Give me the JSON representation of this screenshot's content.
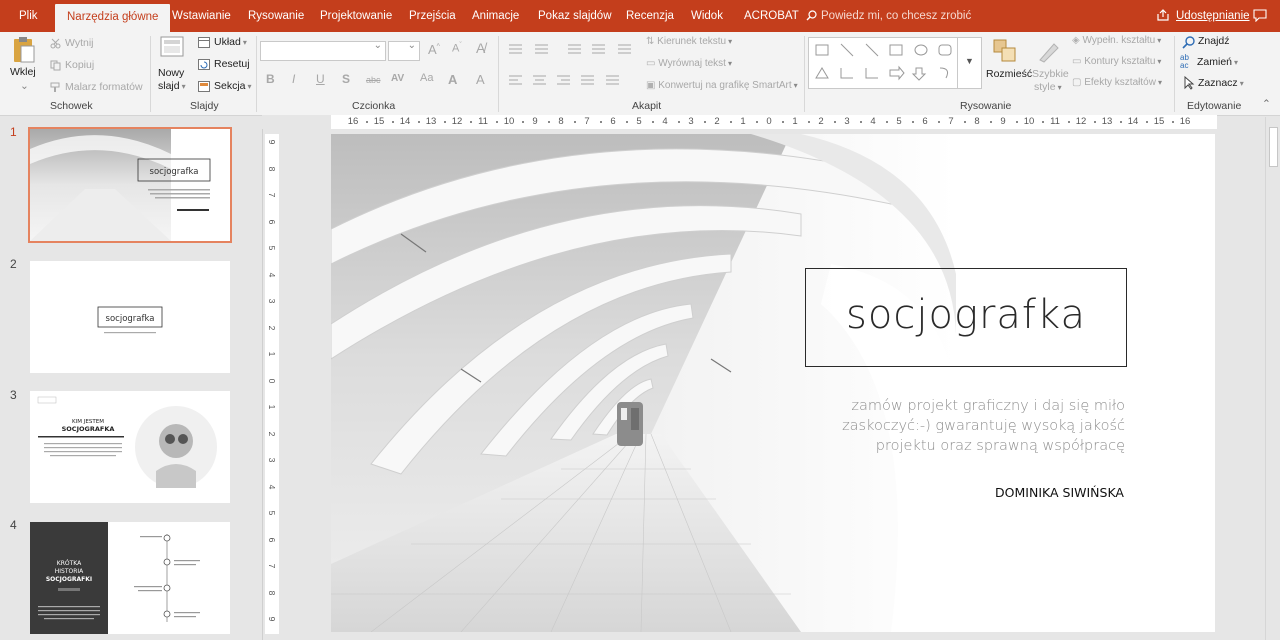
{
  "app": {
    "accent": "#c43e1c"
  },
  "tabs": [
    {
      "label": "Plik"
    },
    {
      "label": "Narzędzia główne"
    },
    {
      "label": "Wstawianie"
    },
    {
      "label": "Rysowanie"
    },
    {
      "label": "Projektowanie"
    },
    {
      "label": "Przejścia"
    },
    {
      "label": "Animacje"
    },
    {
      "label": "Pokaz slajdów"
    },
    {
      "label": "Recenzja"
    },
    {
      "label": "Widok"
    },
    {
      "label": "ACROBAT"
    }
  ],
  "tell_me": "Powiedz mi, co chcesz zrobić",
  "share": "Udostępnianie",
  "ribbon": {
    "clipboard": {
      "label": "Schowek",
      "paste": "Wklej",
      "cut": "Wytnij",
      "copy": "Kopiuj",
      "painter": "Malarz formatów"
    },
    "slides": {
      "label": "Slajdy",
      "new_slide_1": "Nowy",
      "new_slide_2": "slajd",
      "layout": "Układ",
      "reset": "Resetuj",
      "section": "Sekcja"
    },
    "font": {
      "label": "Czcionka",
      "bold": "B",
      "italic": "I",
      "underline": "U",
      "shadow": "S",
      "strike": "abc",
      "spacing": "AV",
      "case": "Aa"
    },
    "paragraph": {
      "label": "Akapit",
      "direction": "Kierunek tekstu",
      "align": "Wyrównaj tekst",
      "smartart": "Konwertuj na grafikę SmartArt"
    },
    "drawing": {
      "label": "Rysowanie",
      "arrange": "Rozmieść",
      "styles_1": "Szybkie",
      "styles_2": "style",
      "fill": "Wypełn. kształtu",
      "outline": "Kontury kształtu",
      "effects": "Efekty kształtów"
    },
    "editing": {
      "label": "Edytowanie",
      "find": "Znajdź",
      "replace": "Zamień",
      "select": "Zaznacz"
    }
  },
  "ruler": {
    "h": [
      "16",
      "15",
      "14",
      "13",
      "12",
      "11",
      "10",
      "9",
      "8",
      "7",
      "6",
      "5",
      "4",
      "3",
      "2",
      "1",
      "0",
      "1",
      "2",
      "3",
      "4",
      "5",
      "6",
      "7",
      "8",
      "9",
      "10",
      "11",
      "12",
      "13",
      "14",
      "15",
      "16"
    ],
    "v": [
      "9",
      "8",
      "7",
      "6",
      "5",
      "4",
      "3",
      "2",
      "1",
      "0",
      "1",
      "2",
      "3",
      "4",
      "5",
      "6",
      "7",
      "8",
      "9"
    ]
  },
  "thumbnails": [
    {
      "num": "1"
    },
    {
      "num": "2"
    },
    {
      "num": "3"
    },
    {
      "num": "4"
    }
  ],
  "thumb_text": {
    "t2_logo": "socjografka",
    "t3_heading_1": "KIM JESTEM",
    "t3_heading_2": "SOCJOGRAFKA",
    "t4_heading_1": "KRÓTKA",
    "t4_heading_2": "HISTORIA",
    "t4_heading_3": "SOCJOGRAFKI"
  },
  "slide": {
    "logo": "socjografka",
    "tagline_1": "zamów projekt graficzny i daj się miło",
    "tagline_2": "zaskoczyć:-) gwarantuję wysoką jakość",
    "tagline_3": "projektu oraz sprawną współpracę",
    "author": "DOMINIKA SIWIŃSKA"
  }
}
